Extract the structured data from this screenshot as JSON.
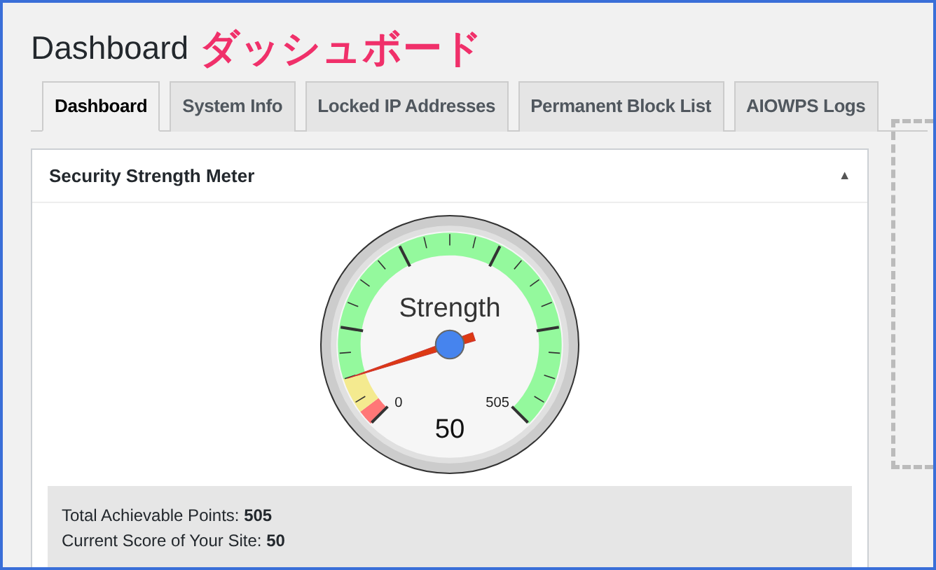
{
  "page": {
    "title": "Dashboard",
    "annotation": "ダッシュボード"
  },
  "tabs": [
    {
      "label": "Dashboard",
      "selected": true
    },
    {
      "label": "System Info",
      "selected": false
    },
    {
      "label": "Locked IP Addresses",
      "selected": false
    },
    {
      "label": "Permanent Block List",
      "selected": false
    },
    {
      "label": "AIOWPS Logs",
      "selected": false
    }
  ],
  "panel": {
    "title": "Security Strength Meter",
    "toggle": "▲",
    "gauge": {
      "label": "Strength",
      "min_label": "0",
      "max_label": "505",
      "reading": "50"
    },
    "stats": [
      "Total Achievable Points: **505**",
      "Current Score of Your Site: **50**"
    ]
  }
}
